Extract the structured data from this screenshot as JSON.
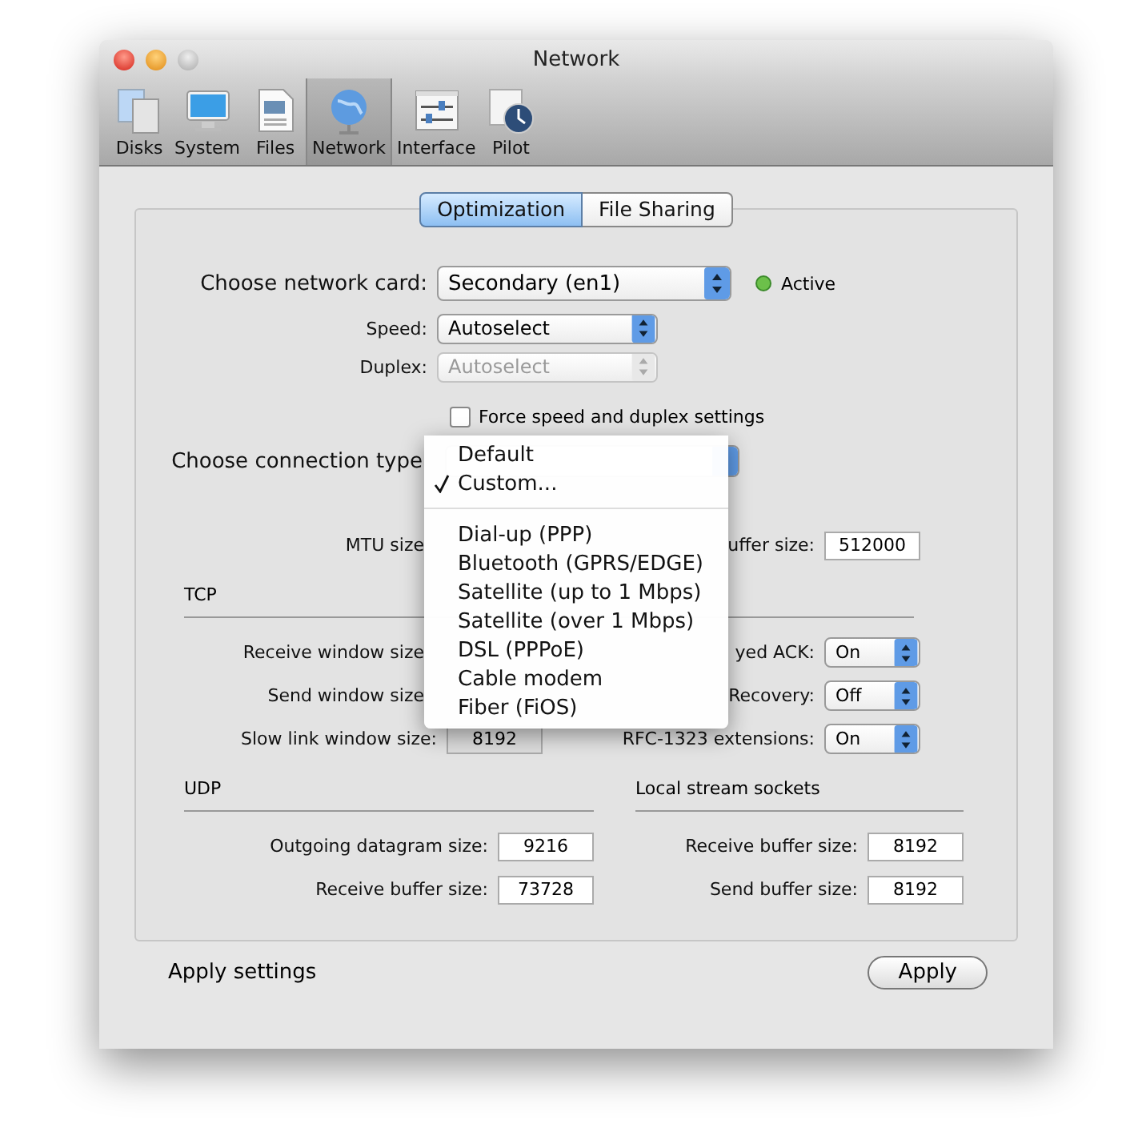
{
  "window": {
    "title": "Network"
  },
  "toolbar": [
    {
      "label": "Disks",
      "selected": false
    },
    {
      "label": "System",
      "selected": false
    },
    {
      "label": "Files",
      "selected": false
    },
    {
      "label": "Network",
      "selected": true
    },
    {
      "label": "Interface",
      "selected": false
    },
    {
      "label": "Pilot",
      "selected": false
    }
  ],
  "tabs": [
    {
      "label": "Optimization",
      "selected": true
    },
    {
      "label": "File Sharing",
      "selected": false
    }
  ],
  "network_card": {
    "label": "Choose network card:",
    "value": "Secondary (en1)",
    "status": "Active"
  },
  "speed": {
    "label": "Speed:",
    "value": "Autoselect",
    "disabled": false
  },
  "duplex": {
    "label": "Duplex:",
    "value": "Autoselect",
    "disabled": true
  },
  "force_checkbox": {
    "label": "Force speed and duplex settings",
    "checked": false
  },
  "connection_type": {
    "label": "Choose connection type"
  },
  "mtu": {
    "label": "MTU size",
    "right_label": "uffer size:",
    "right_value": "512000"
  },
  "tcp": {
    "title": "TCP",
    "rows": [
      {
        "left_label": "Receive window size",
        "right_label": "yed ACK:",
        "right_value": "On"
      },
      {
        "left_label": "Send window size",
        "right_label": "Recovery:",
        "right_value": "Off"
      },
      {
        "left_label": "Slow link window size:",
        "left_value": "8192",
        "right_label": "RFC-1323 extensions:",
        "right_value": "On"
      }
    ]
  },
  "udp": {
    "title": "UDP",
    "rows": [
      {
        "label": "Outgoing datagram size:",
        "value": "9216"
      },
      {
        "label": "Receive buffer size:",
        "value": "73728"
      }
    ]
  },
  "local_stream_sockets": {
    "title": "Local stream sockets",
    "rows": [
      {
        "label": "Receive buffer size:",
        "value": "8192"
      },
      {
        "label": "Send buffer size:",
        "value": "8192"
      }
    ]
  },
  "footer": {
    "label": "Apply settings",
    "button": "Apply"
  },
  "menu": {
    "items": [
      {
        "kind": "item",
        "label": "Default",
        "selected": false
      },
      {
        "kind": "item",
        "label": "Custom...",
        "selected": true
      },
      {
        "kind": "separator"
      },
      {
        "kind": "item",
        "label": "Dial-up (PPP)",
        "selected": false
      },
      {
        "kind": "item",
        "label": "Bluetooth (GPRS/EDGE)",
        "selected": false
      },
      {
        "kind": "item",
        "label": "Satellite (up to 1 Mbps)",
        "selected": false
      },
      {
        "kind": "item",
        "label": "Satellite (over 1 Mbps)",
        "selected": false
      },
      {
        "kind": "item",
        "label": "DSL (PPPoE)",
        "selected": false
      },
      {
        "kind": "item",
        "label": "Cable modem",
        "selected": false
      },
      {
        "kind": "item",
        "label": "Fiber (FiOS)",
        "selected": false
      }
    ]
  }
}
